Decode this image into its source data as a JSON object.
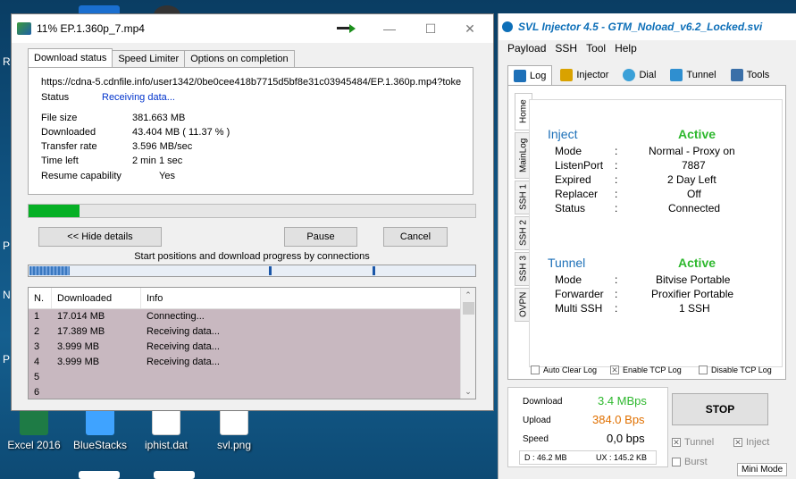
{
  "desktop": {
    "icons": [
      {
        "label": "Excel 2016",
        "color": "#1e7b45"
      },
      {
        "label": "BlueStacks",
        "color": "#3fa3ff"
      },
      {
        "label": "iphist.dat",
        "color": "#ffffff"
      },
      {
        "label": "svl.png",
        "color": "#ffffff"
      }
    ],
    "left_letters": [
      "R",
      "P",
      "N",
      "P"
    ]
  },
  "idm": {
    "title": "11% EP.1.360p_7.mp4",
    "tabs": [
      "Download status",
      "Speed Limiter",
      "Options on completion"
    ],
    "url": "https://cdna-5.cdnfile.info/user1342/0be0cee418b7715d5bf8e31c03945484/EP.1.360p.mp4?toke",
    "status_label": "Status",
    "status_value": "Receiving data...",
    "fields": [
      {
        "label": "File size",
        "value": "381.663  MB"
      },
      {
        "label": "Downloaded",
        "value": "43.404  MB  ( 11.37 % )"
      },
      {
        "label": "Transfer rate",
        "value": "3.596  MB/sec"
      },
      {
        "label": "Time left",
        "value": "2 min 1 sec"
      },
      {
        "label": "Resume capability",
        "value": "Yes"
      }
    ],
    "progress": 0.1137,
    "buttons": {
      "hide": "<< Hide details",
      "pause": "Pause",
      "cancel": "Cancel"
    },
    "conn_label": "Start positions and download progress by connections",
    "list_headers": [
      "N.",
      "Downloaded",
      "Info"
    ],
    "connections": [
      {
        "n": "1",
        "downloaded": "17.014  MB",
        "info": "Connecting..."
      },
      {
        "n": "2",
        "downloaded": "17.389  MB",
        "info": "Receiving data..."
      },
      {
        "n": "3",
        "downloaded": "3.999  MB",
        "info": "Receiving data..."
      },
      {
        "n": "4",
        "downloaded": "3.999  MB",
        "info": "Receiving data..."
      },
      {
        "n": "5",
        "downloaded": "",
        "info": ""
      },
      {
        "n": "6",
        "downloaded": "",
        "info": ""
      }
    ]
  },
  "svl": {
    "title": "SVL Injector 4.5 - GTM_Noload_v6.2_Locked.svi",
    "menu": [
      "Payload",
      "SSH",
      "Tool",
      "Help"
    ],
    "tabs": [
      "Log",
      "Injector",
      "Dial",
      "Tunnel",
      "Tools"
    ],
    "vtabs": [
      "Home",
      "MainLog",
      "SSH 1",
      "SSH 2",
      "SSH 3",
      "OVPN"
    ],
    "inject": {
      "title": "Inject",
      "state": "Active",
      "rows": [
        {
          "k": "Mode",
          "v": "Normal - Proxy on"
        },
        {
          "k": "ListenPort",
          "v": "7887"
        },
        {
          "k": "Expired",
          "v": "2 Day Left"
        },
        {
          "k": "Replacer",
          "v": "Off"
        },
        {
          "k": "Status",
          "v": "Connected"
        }
      ]
    },
    "tunnel": {
      "title": "Tunnel",
      "state": "Active",
      "rows": [
        {
          "k": "Mode",
          "v": "Bitvise Portable"
        },
        {
          "k": "Forwarder",
          "v": "Proxifier Portable"
        },
        {
          "k": "Multi SSH",
          "v": "1 SSH"
        }
      ]
    },
    "checks": [
      "Auto Clear Log",
      "Enable TCP Log",
      "Disable TCP Log"
    ],
    "stats": {
      "download_label": "Download",
      "download": "3.4 MBps",
      "upload_label": "Upload",
      "upload": "384.0 Bps",
      "speed_label": "Speed",
      "speed": "0,0 bps",
      "d": "D :    46.2 MB",
      "u": "UX :    145.2 KB"
    },
    "stop": "STOP",
    "options": [
      "Tunnel",
      "Inject",
      "Burst"
    ],
    "mini_mode": "Mini Mode",
    "colors": {
      "accent": "#1d70b8",
      "active": "#2eb82e",
      "download": "#2eb82e",
      "upload": "#e07000"
    }
  }
}
